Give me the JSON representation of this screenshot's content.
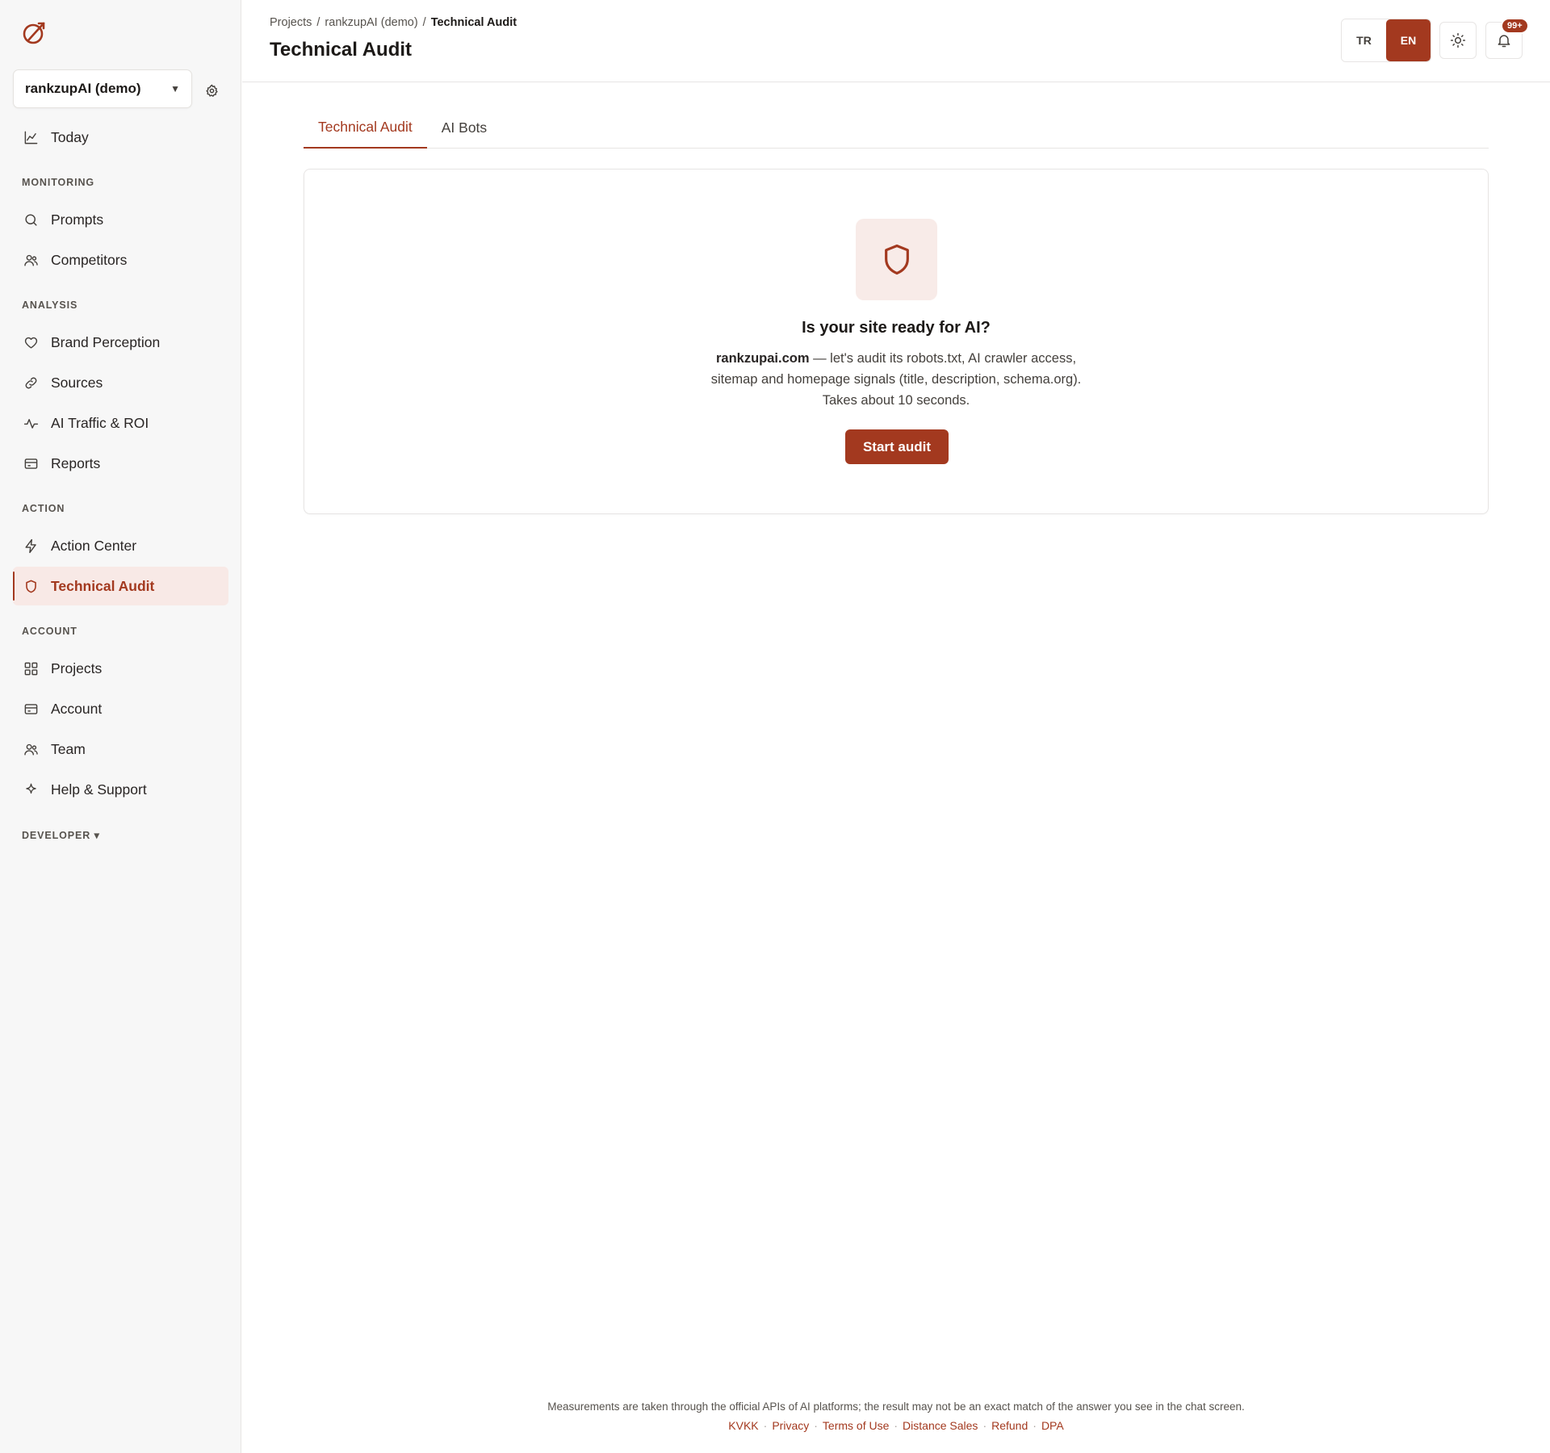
{
  "colors": {
    "accent": "#a3391f",
    "accent_soft": "#f8e9e6"
  },
  "sidebar": {
    "project_name": "rankzupAI (demo)",
    "items": [
      {
        "label": "Today",
        "icon": "chart-line-icon"
      },
      {
        "section": "MONITORING"
      },
      {
        "label": "Prompts",
        "icon": "search-icon"
      },
      {
        "label": "Competitors",
        "icon": "users-icon"
      },
      {
        "section": "ANALYSIS"
      },
      {
        "label": "Brand Perception",
        "icon": "heart-icon"
      },
      {
        "label": "Sources",
        "icon": "link-icon"
      },
      {
        "label": "AI Traffic & ROI",
        "icon": "activity-icon"
      },
      {
        "label": "Reports",
        "icon": "card-icon"
      },
      {
        "section": "ACTION"
      },
      {
        "label": "Action Center",
        "icon": "lightning-icon"
      },
      {
        "label": "Technical Audit",
        "icon": "shield-icon",
        "active": true
      },
      {
        "section": "ACCOUNT"
      },
      {
        "label": "Projects",
        "icon": "grid-icon"
      },
      {
        "label": "Account",
        "icon": "card-icon"
      },
      {
        "label": "Team",
        "icon": "users-icon"
      },
      {
        "label": "Help & Support",
        "icon": "sparkle-icon"
      },
      {
        "section": "DEVELOPER ▾"
      }
    ]
  },
  "header": {
    "breadcrumb": [
      "Projects",
      "/",
      "rankzupAI (demo)",
      "/",
      "Technical Audit"
    ],
    "title": "Technical Audit",
    "lang_tr": "TR",
    "lang_en": "EN",
    "lang_selected": "EN",
    "notifications_badge": "99+"
  },
  "tabs": [
    {
      "label": "Technical Audit",
      "active": true
    },
    {
      "label": "AI Bots",
      "active": false
    }
  ],
  "card": {
    "title": "Is your site ready for AI?",
    "domain": "rankzupai.com",
    "desc_line1": " — let's audit its robots.txt, AI crawler access,",
    "desc_line2": "sitemap and homepage signals (title, description, schema.org).",
    "desc_line3": "Takes about 10 seconds.",
    "button": "Start audit"
  },
  "footer": {
    "note": "Measurements are taken through the official APIs of AI platforms; the result may not be an exact match of the answer you see in the chat screen.",
    "links": [
      "KVKK",
      "Privacy",
      "Terms of Use",
      "Distance Sales",
      "Refund",
      "DPA"
    ],
    "separator": "·"
  }
}
